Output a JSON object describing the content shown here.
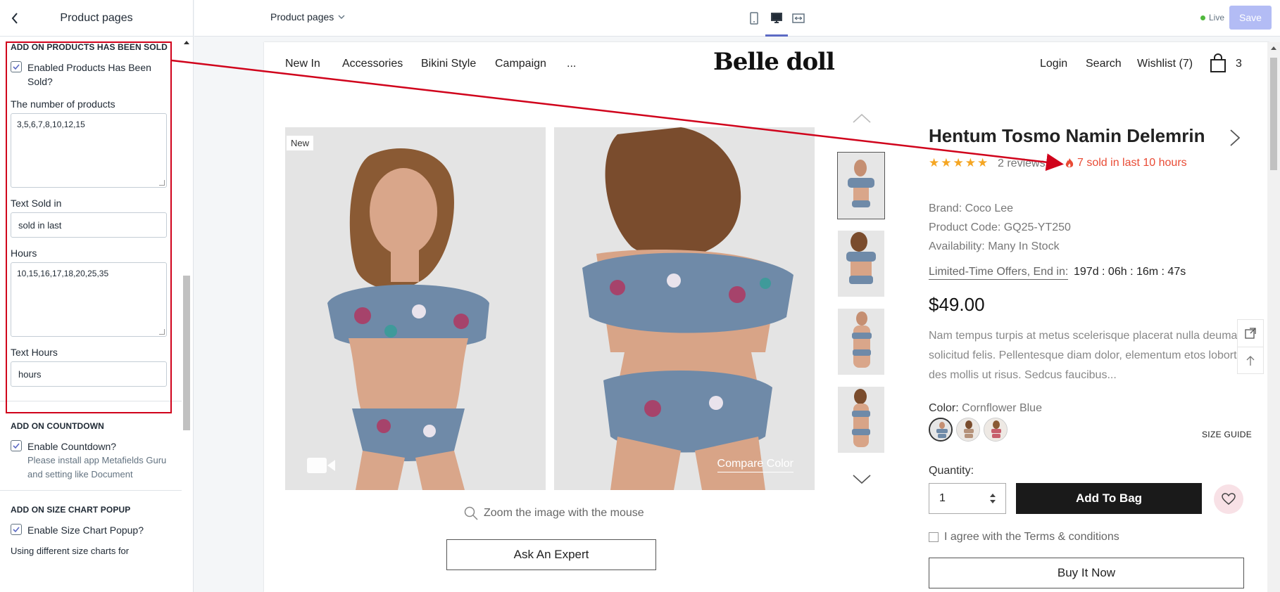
{
  "sidebar": {
    "title": "Product pages",
    "sections": {
      "sold": {
        "title": "ADD ON PRODUCTS HAS BEEN SOLD",
        "checkbox_label": "Enabled Products Has Been Sold?",
        "checked": true,
        "num_label": "The number of products",
        "num_value": "3,5,6,7,8,10,12,15",
        "text_sold_label": "Text Sold in",
        "text_sold_value": "sold in last",
        "hours_label": "Hours",
        "hours_value": "10,15,16,17,18,20,25,35",
        "text_hours_label": "Text Hours",
        "text_hours_value": "hours"
      },
      "countdown": {
        "title": "ADD ON COUNTDOWN",
        "checkbox_label": "Enable Countdown?",
        "checked": true,
        "help": "Please install app Metafields Guru and setting like Document"
      },
      "size_chart": {
        "title": "ADD ON SIZE CHART POPUP",
        "checkbox_label": "Enable Size Chart Popup?",
        "checked": true,
        "help": "Using different size charts for"
      }
    }
  },
  "topbar": {
    "page_selector": "Product pages",
    "live_label": "Live",
    "save_label": "Save",
    "active_device": "desktop"
  },
  "store": {
    "nav": [
      "New In",
      "Accessories",
      "Bikini Style",
      "Campaign",
      "..."
    ],
    "logo": "Belle doll",
    "right_nav": [
      "Login",
      "Search",
      "Wishlist (7)"
    ],
    "cart_count": "3"
  },
  "product": {
    "badge": "New",
    "compare_color": "Compare Color",
    "zoom_hint": "Zoom the image with the mouse",
    "ask_expert": "Ask An Expert",
    "title": "Hentum Tosmo Namin Delemrin",
    "rating": 5,
    "stars": "★★★★★",
    "reviews": "2 reviews",
    "sold_text": "7 sold in last 10 hours",
    "brand": "Brand: Coco Lee",
    "code": "Product Code: GQ25-YT250",
    "availability": "Availability: Many In Stock",
    "offer_label": "Limited-Time Offers, End in:",
    "countdown": "197d : 06h : 16m : 47s",
    "price": "$49.00",
    "description": [
      "Nam tempus turpis at metus scelerisque placerat nulla deumantos",
      "solicitud felis. Pellentesque diam dolor, elementum etos lobortis",
      "des mollis ut risus. Sedcus faucibus..."
    ],
    "color_label": "Color:",
    "color_value": "Cornflower Blue",
    "size_guide": "SIZE GUIDE",
    "quantity_label": "Quantity:",
    "quantity": "1",
    "add_to_bag": "Add To Bag",
    "agree": "I agree with the Terms & conditions",
    "buy_now": "Buy It Now"
  },
  "colors": {
    "accent": "#5c6ac4",
    "annotation_red": "#d0021b",
    "sold_red": "#e94b35",
    "star": "#f5a623",
    "print_blue": "#6f8aa8"
  }
}
